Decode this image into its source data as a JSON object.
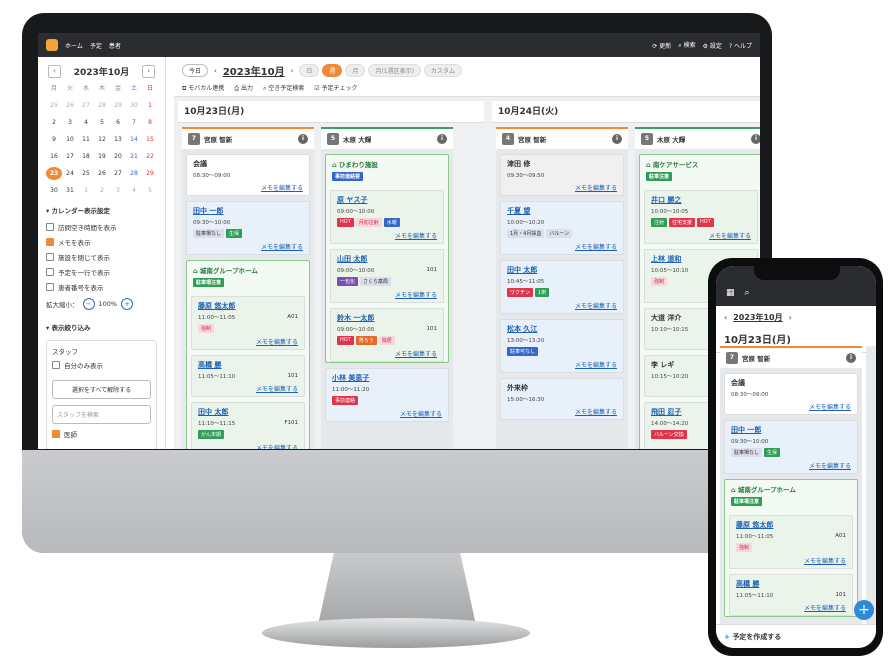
{
  "topbar": {
    "home": "ホーム",
    "schedule": "予定",
    "patients": "患者",
    "refresh": "更新",
    "search": "検索",
    "settings": "設定",
    "help": "ヘルプ"
  },
  "calendar": {
    "title": "2023年10月",
    "dow": [
      "月",
      "火",
      "水",
      "木",
      "金",
      "土",
      "日"
    ],
    "days": [
      "25",
      "26",
      "27",
      "28",
      "29",
      "30",
      "1",
      "2",
      "3",
      "4",
      "5",
      "6",
      "7",
      "8",
      "9",
      "10",
      "11",
      "12",
      "13",
      "14",
      "15",
      "16",
      "17",
      "18",
      "19",
      "20",
      "21",
      "22",
      "23",
      "24",
      "25",
      "26",
      "27",
      "28",
      "29",
      "30",
      "31",
      "1",
      "2",
      "3",
      "4",
      "5"
    ],
    "today": "23"
  },
  "settings": {
    "title": "カレンダー表示設定",
    "options": [
      "訪問空き時間を表示",
      "メモを表示",
      "施設を閉じて表示",
      "予定を一行で表示",
      "患者番号を表示"
    ],
    "checked": [
      false,
      true,
      false,
      false,
      false
    ],
    "zoom_label": "拡大縮小：",
    "zoom_value": "100%"
  },
  "filter": {
    "title": "表示絞り込み",
    "staff": "スタッフ",
    "only_self": "自分のみ表示",
    "select_all": "選択をすべて解除する",
    "search_placeholder": "スタッフを検索",
    "role": "医師"
  },
  "toolbar": {
    "today": "今日",
    "month": "2023年10月",
    "views": [
      "日",
      "週",
      "月",
      "月(1週区表示)",
      "カスタム"
    ],
    "actions": [
      "モバカル連携",
      "出力",
      "空き予定検索",
      "予定チェック"
    ]
  },
  "day1": {
    "label": "10月23日(月)",
    "staff": [
      {
        "num": "7",
        "name": "宮原 智新"
      },
      {
        "num": "5",
        "name": "木原 大輝"
      }
    ]
  },
  "day2": {
    "label": "10月24日(火)",
    "staff": [
      {
        "num": "4",
        "name": "宮原 智新"
      },
      {
        "num": "5",
        "name": "木原 大輝"
      }
    ]
  },
  "memo_link": "メモを編集する",
  "cards1": [
    {
      "name": "会議",
      "time": "08:30〜09:00"
    },
    {
      "name": "田中 一郎",
      "time": "09:30〜10:00",
      "tags": [
        "駐車場なし",
        "生保"
      ]
    }
  ],
  "group1": {
    "name": "城南グループホーム",
    "tag": "駐車場注意",
    "cards": [
      {
        "name": "藤原 悠太郎",
        "time": "11:00〜11:05",
        "room": "A01",
        "tags": [
          "強制"
        ]
      },
      {
        "name": "高橋 勝",
        "time": "11:05〜11:10",
        "room": "101"
      },
      {
        "name": "田中 太郎",
        "time": "11:10〜11:15",
        "room": "F101",
        "tags": [
          "がん末期"
        ]
      }
    ]
  },
  "group2": {
    "name": "ひまわり施設",
    "tag": "事前連絡要",
    "cards": [
      {
        "name": "原 ヤス子",
        "time": "09:00〜10:00",
        "tags": [
          "HOT",
          "月初注射",
          "水曜"
        ]
      },
      {
        "name": "山田 太郎",
        "time": "09:00〜10:00",
        "room": "101",
        "tags": [
          "一包化",
          "さくら薬局"
        ]
      },
      {
        "name": "鈴木 一太郎",
        "time": "09:00〜10:00",
        "room": "101",
        "tags": [
          "HOT",
          "胃ろう",
          "独居"
        ]
      }
    ]
  },
  "card_small": {
    "name": "小林 美恵子",
    "time": "11:00〜11:20",
    "tags": [
      "事前連絡"
    ]
  },
  "cards3": [
    {
      "name": "津田 修",
      "time": "09:30〜09:50"
    },
    {
      "name": "千夏 望",
      "time": "10:00〜10:20",
      "tags": [
        "1月・4月採血",
        "バルーン"
      ]
    },
    {
      "name": "田中 太郎",
      "time": "10:45〜11:05",
      "tags": [
        "ワクチン",
        "1剤"
      ]
    },
    {
      "name": "松本 久江",
      "time": "13:00〜13:20",
      "tags": [
        "駐車可なし"
      ]
    },
    {
      "name": "外来枠",
      "time": "15:00〜16:30"
    }
  ],
  "group3": {
    "name": "南ケアサービス",
    "tag": "駐車注意",
    "cards": [
      {
        "name": "井口 勝之",
        "time": "10:00〜10:05",
        "tags": [
          "注射",
          "住宅支援",
          "HOT"
        ]
      },
      {
        "name": "上林 道和",
        "time": "10:05〜10:10",
        "tags": [
          "強制"
        ]
      },
      {
        "name": "大道 洋介",
        "time": "10:10〜10:15"
      },
      {
        "name": "李 レギ",
        "time": "10:15〜10:20"
      },
      {
        "name": "飛田 忍子",
        "time": "14:00〜14:20",
        "tags": [
          "バルーン交換"
        ]
      }
    ]
  },
  "phone": {
    "month": "2023年10月",
    "date": "10月23日(月)",
    "staff": "宮原 智新",
    "num": "7",
    "create": "予定を作成する"
  }
}
